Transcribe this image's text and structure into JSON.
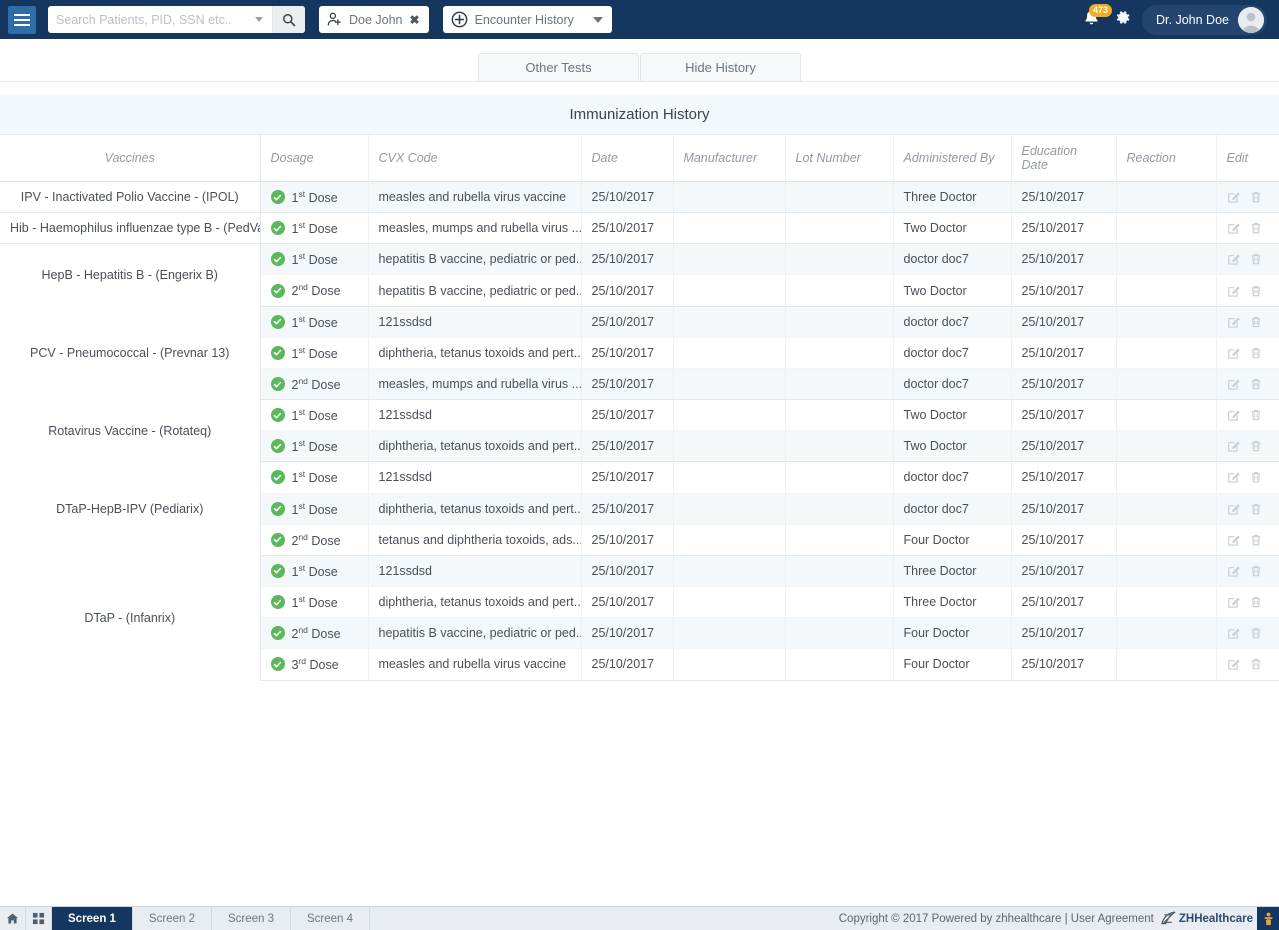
{
  "header": {
    "menu_icon": "hamburger-icon",
    "search": {
      "placeholder": "Search Patients, PID, SSN etc..",
      "value": "",
      "dropdown_icon": "chevron-down-icon",
      "search_icon": "search-icon"
    },
    "patient_chip": {
      "icon": "add-user-icon",
      "label": "Doe John",
      "close_icon": "close-icon"
    },
    "encounter_chip": {
      "icon": "plus-circle-icon",
      "label": "Encounter History",
      "caret_icon": "caret-down-icon"
    },
    "notifications": {
      "icon": "bell-icon",
      "count": "473",
      "badge_color": "#f0ad1e"
    },
    "settings_icon": "gear-icon",
    "user": {
      "name": "Dr. John Doe",
      "avatar_icon": "avatar-icon"
    },
    "bg_color": "#15365f"
  },
  "tabs": [
    {
      "label": "Other Tests"
    },
    {
      "label": "Hide History"
    }
  ],
  "panel": {
    "title": "Immunization History"
  },
  "table": {
    "columns": [
      "Vaccines",
      "Dosage",
      "CVX Code",
      "Date",
      "Manufacturer",
      "Lot Number",
      "Administered By",
      "Education Date",
      "Reaction",
      "Edit"
    ],
    "edit_icon": "edit-pencil-icon",
    "delete_icon": "trash-icon",
    "dose_status_icon": "check-circle-icon",
    "status_color": "#5cb85c",
    "groups": [
      {
        "vaccine": "IPV - Inactivated Polio Vaccine - (IPOL)",
        "rows": [
          {
            "dose_num": "1",
            "dose_ord": "st",
            "dose_label": "Dose",
            "cvx": "measles and rubella virus vaccine",
            "date": "25/10/2017",
            "manufacturer": "",
            "lot": "",
            "administered_by": "Three Doctor",
            "education_date": "25/10/2017",
            "reaction": ""
          }
        ]
      },
      {
        "vaccine": "Hib - Haemophilus influenzae type B - (PedVax)",
        "rows": [
          {
            "dose_num": "1",
            "dose_ord": "st",
            "dose_label": "Dose",
            "cvx": "measles, mumps and rubella virus ...",
            "date": "25/10/2017",
            "manufacturer": "",
            "lot": "",
            "administered_by": "Two Doctor",
            "education_date": "25/10/2017",
            "reaction": ""
          }
        ]
      },
      {
        "vaccine": "HepB - Hepatitis B - (Engerix B)",
        "rows": [
          {
            "dose_num": "1",
            "dose_ord": "st",
            "dose_label": "Dose",
            "cvx": "hepatitis B vaccine, pediatric or ped...",
            "date": "25/10/2017",
            "manufacturer": "",
            "lot": "",
            "administered_by": "doctor doc7",
            "education_date": "25/10/2017",
            "reaction": ""
          },
          {
            "dose_num": "2",
            "dose_ord": "nd",
            "dose_label": "Dose",
            "cvx": "hepatitis B vaccine, pediatric or ped...",
            "date": "25/10/2017",
            "manufacturer": "",
            "lot": "",
            "administered_by": "Two Doctor",
            "education_date": "25/10/2017",
            "reaction": ""
          }
        ]
      },
      {
        "vaccine": "PCV - Pneumococcal - (Prevnar 13)",
        "rows": [
          {
            "dose_num": "1",
            "dose_ord": "st",
            "dose_label": "Dose",
            "cvx": "121ssdsd",
            "date": "25/10/2017",
            "manufacturer": "",
            "lot": "",
            "administered_by": "doctor doc7",
            "education_date": "25/10/2017",
            "reaction": ""
          },
          {
            "dose_num": "1",
            "dose_ord": "st",
            "dose_label": "Dose",
            "cvx": "diphtheria, tetanus toxoids and pert...",
            "date": "25/10/2017",
            "manufacturer": "",
            "lot": "",
            "administered_by": "doctor doc7",
            "education_date": "25/10/2017",
            "reaction": ""
          },
          {
            "dose_num": "2",
            "dose_ord": "nd",
            "dose_label": "Dose",
            "cvx": "measles, mumps and rubella virus ...",
            "date": "25/10/2017",
            "manufacturer": "",
            "lot": "",
            "administered_by": "doctor doc7",
            "education_date": "25/10/2017",
            "reaction": ""
          }
        ]
      },
      {
        "vaccine": "Rotavirus Vaccine - (Rotateq)",
        "rows": [
          {
            "dose_num": "1",
            "dose_ord": "st",
            "dose_label": "Dose",
            "cvx": "121ssdsd",
            "date": "25/10/2017",
            "manufacturer": "",
            "lot": "",
            "administered_by": "Two Doctor",
            "education_date": "25/10/2017",
            "reaction": ""
          },
          {
            "dose_num": "1",
            "dose_ord": "st",
            "dose_label": "Dose",
            "cvx": "diphtheria, tetanus toxoids and pert...",
            "date": "25/10/2017",
            "manufacturer": "",
            "lot": "",
            "administered_by": "Two Doctor",
            "education_date": "25/10/2017",
            "reaction": ""
          }
        ]
      },
      {
        "vaccine": "DTaP-HepB-IPV (Pediarix)",
        "rows": [
          {
            "dose_num": "1",
            "dose_ord": "st",
            "dose_label": "Dose",
            "cvx": "121ssdsd",
            "date": "25/10/2017",
            "manufacturer": "",
            "lot": "",
            "administered_by": "doctor doc7",
            "education_date": "25/10/2017",
            "reaction": ""
          },
          {
            "dose_num": "1",
            "dose_ord": "st",
            "dose_label": "Dose",
            "cvx": "diphtheria, tetanus toxoids and pert...",
            "date": "25/10/2017",
            "manufacturer": "",
            "lot": "",
            "administered_by": "doctor doc7",
            "education_date": "25/10/2017",
            "reaction": ""
          },
          {
            "dose_num": "2",
            "dose_ord": "nd",
            "dose_label": "Dose",
            "cvx": "tetanus and diphtheria toxoids, ads...",
            "date": "25/10/2017",
            "manufacturer": "",
            "lot": "",
            "administered_by": "Four Doctor",
            "education_date": "25/10/2017",
            "reaction": ""
          }
        ]
      },
      {
        "vaccine": "DTaP - (Infanrix)",
        "rows": [
          {
            "dose_num": "1",
            "dose_ord": "st",
            "dose_label": "Dose",
            "cvx": "121ssdsd",
            "date": "25/10/2017",
            "manufacturer": "",
            "lot": "",
            "administered_by": "Three Doctor",
            "education_date": "25/10/2017",
            "reaction": ""
          },
          {
            "dose_num": "1",
            "dose_ord": "st",
            "dose_label": "Dose",
            "cvx": "diphtheria, tetanus toxoids and pert...",
            "date": "25/10/2017",
            "manufacturer": "",
            "lot": "",
            "administered_by": "Three Doctor",
            "education_date": "25/10/2017",
            "reaction": ""
          },
          {
            "dose_num": "2",
            "dose_ord": "nd",
            "dose_label": "Dose",
            "cvx": "hepatitis B vaccine, pediatric or ped...",
            "date": "25/10/2017",
            "manufacturer": "",
            "lot": "",
            "administered_by": "Four Doctor",
            "education_date": "25/10/2017",
            "reaction": ""
          },
          {
            "dose_num": "3",
            "dose_ord": "rd",
            "dose_label": "Dose",
            "cvx": "measles and rubella virus vaccine",
            "date": "25/10/2017",
            "manufacturer": "",
            "lot": "",
            "administered_by": "Four Doctor",
            "education_date": "25/10/2017",
            "reaction": ""
          }
        ]
      }
    ]
  },
  "taskbar": {
    "home_icon": "home-icon",
    "apps_icon": "grid-apps-icon",
    "screens": [
      {
        "label": "Screen 1",
        "active": true
      },
      {
        "label": "Screen 2",
        "active": false
      },
      {
        "label": "Screen 3",
        "active": false
      },
      {
        "label": "Screen 4",
        "active": false
      }
    ],
    "copyright": "Copyright © 2017 Powered by zhhealthcare | User Agreement",
    "brand": "ZHHealthcare",
    "brand_icon": "zh-logo-icon",
    "end_icon": "status-icon"
  }
}
